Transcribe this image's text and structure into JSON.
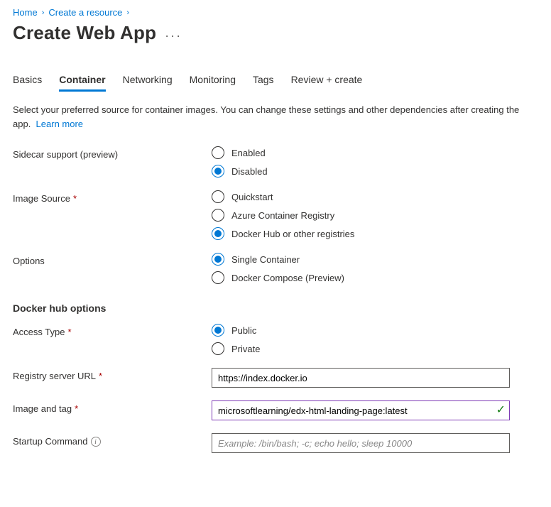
{
  "breadcrumb": {
    "home": "Home",
    "create_resource": "Create a resource"
  },
  "page": {
    "title": "Create Web App"
  },
  "tabs": {
    "basics": "Basics",
    "container": "Container",
    "networking": "Networking",
    "monitoring": "Monitoring",
    "tags": "Tags",
    "review": "Review + create"
  },
  "description": {
    "text": "Select your preferred source for container images. You can change these settings and other dependencies after creating the app.",
    "learn_more": "Learn more"
  },
  "labels": {
    "sidecar": "Sidecar support (preview)",
    "image_source": "Image Source",
    "options": "Options",
    "docker_hub_section": "Docker hub options",
    "access_type": "Access Type",
    "registry_url": "Registry server URL",
    "image_tag": "Image and tag",
    "startup_cmd": "Startup Command"
  },
  "radios": {
    "enabled": "Enabled",
    "disabled": "Disabled",
    "quickstart": "Quickstart",
    "acr": "Azure Container Registry",
    "dockerhub": "Docker Hub or other registries",
    "single": "Single Container",
    "compose": "Docker Compose (Preview)",
    "public": "Public",
    "private": "Private"
  },
  "inputs": {
    "registry_value": "https://index.docker.io",
    "image_tag_value": "microsoftlearning/edx-html-landing-page:latest",
    "startup_placeholder": "Example: /bin/bash; -c; echo hello; sleep 10000"
  }
}
